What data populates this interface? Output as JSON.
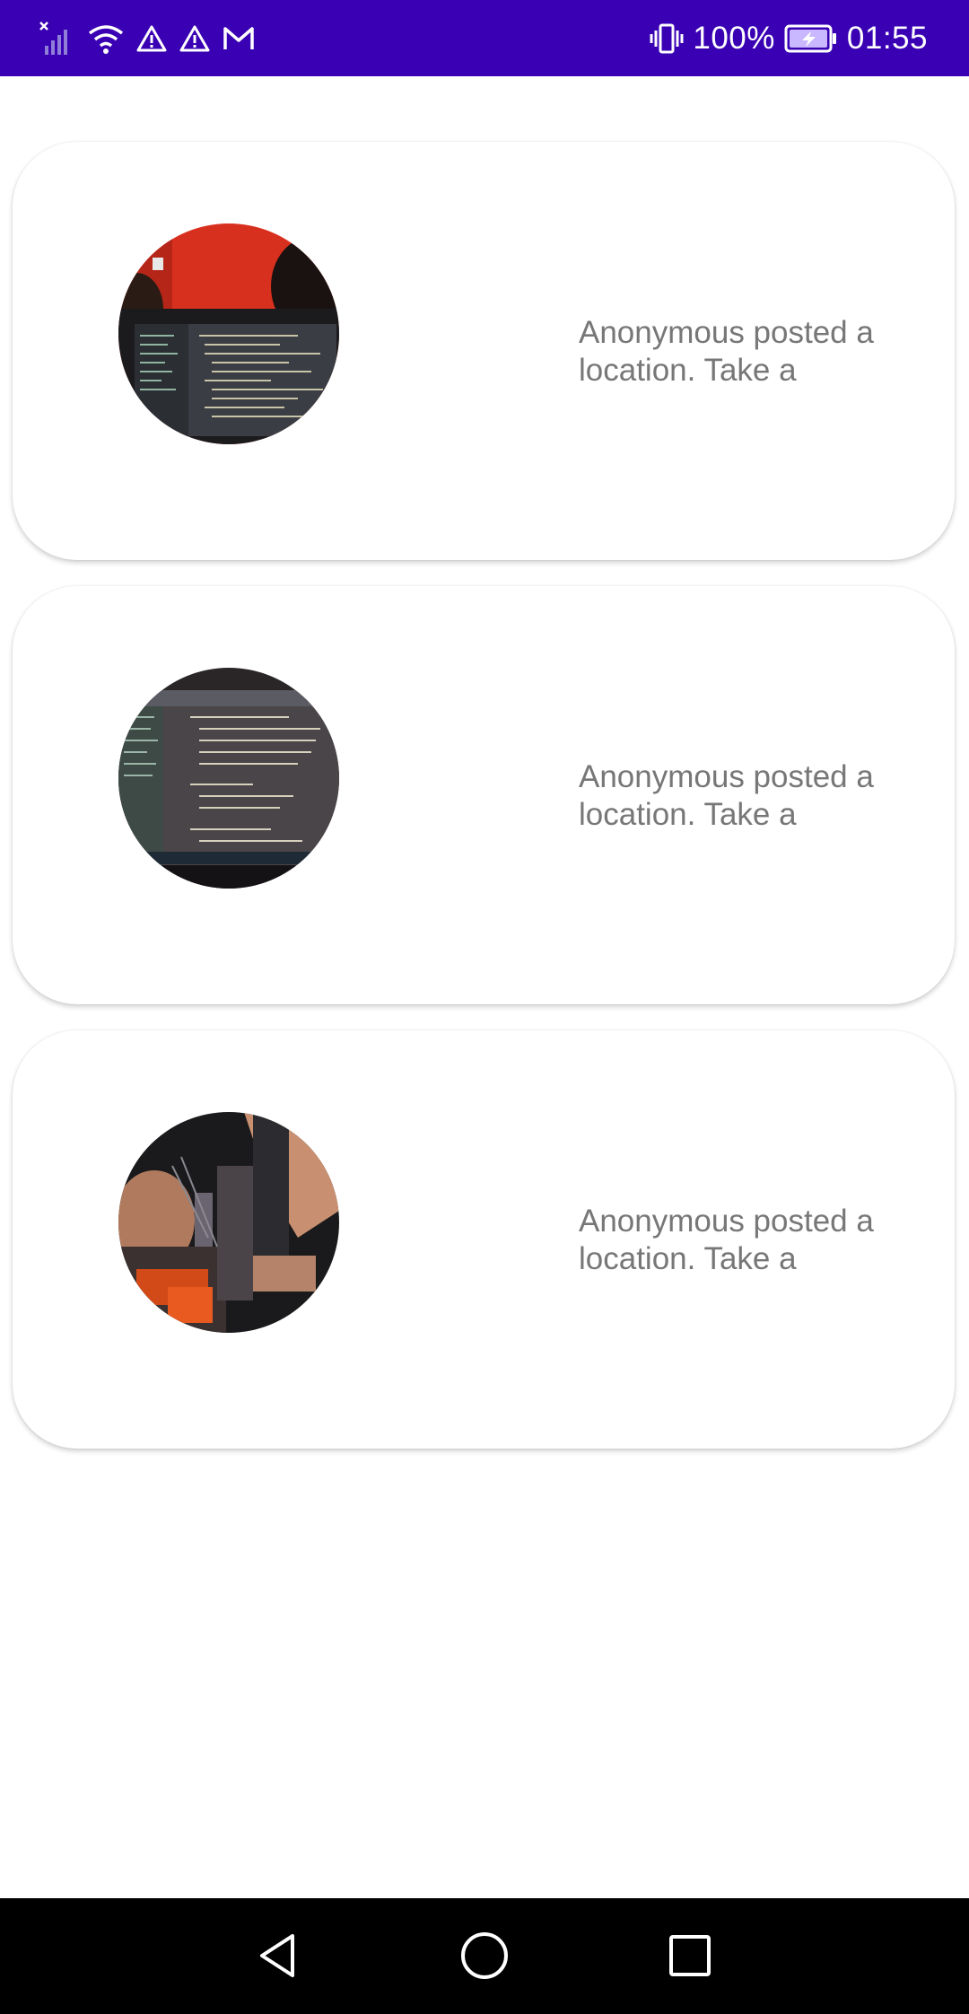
{
  "status_bar": {
    "battery": "100%",
    "time": "01:55",
    "background_color": "#3a00b4",
    "left_icons": [
      "signal-off-icon",
      "wifi-icon",
      "warning-icon",
      "warning-icon",
      "gmail-icon"
    ],
    "right_icons": [
      "vibrate-icon",
      "battery-charging-icon"
    ]
  },
  "feed": {
    "posts": [
      {
        "text": "Anonymous posted a location. Take a",
        "image": "photo-laptop-code-red-wall"
      },
      {
        "text": "Anonymous posted a location. Take a",
        "image": "photo-laptop-screen-code"
      },
      {
        "text": "Anonymous posted a location. Take a",
        "image": "photo-person-at-desk-rotated"
      }
    ]
  },
  "nav_bar": {
    "icons": [
      "back-icon",
      "home-icon",
      "recents-icon"
    ]
  }
}
